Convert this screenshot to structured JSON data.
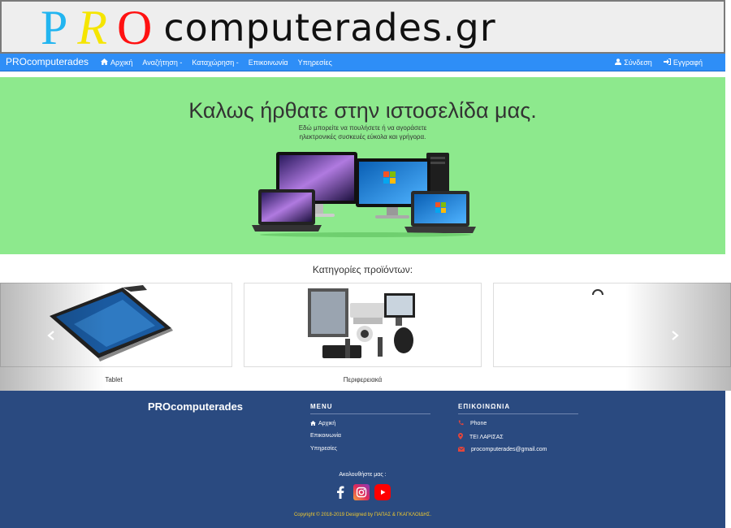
{
  "logo": {
    "letter_p": "P",
    "letter_r": "R",
    "letter_o": "O",
    "rest": "computerades.gr",
    "colors": {
      "p": "#22b5f0",
      "r": "#f5e500",
      "o": "#ff1111"
    }
  },
  "navbar": {
    "brand": "PROcomputerades",
    "links": [
      {
        "label": "Αρχική",
        "icon": "home-icon"
      },
      {
        "label": "Αναζήτηση -"
      },
      {
        "label": "Καταχώρηση -"
      },
      {
        "label": "Επικοινωνία"
      },
      {
        "label": "Υπηρεσίες"
      }
    ],
    "right": [
      {
        "label": "Σύνδεση",
        "icon": "user-icon"
      },
      {
        "label": "Εγγραφή",
        "icon": "sign-in-icon"
      }
    ],
    "color": "#2e8ef7"
  },
  "hero": {
    "title": "Καλως ήρθατε στην ιστοσελίδα μας.",
    "subtitle_line1": "Εδώ μπορείτε να πουλήσετε ή να αγοράσετε",
    "subtitle_line2": "ηλεκτρονικές συσκευές εύκολα και γρήγορα.",
    "background": "#8de98d"
  },
  "categories": {
    "title": "Κατηγορίες προϊόντων:",
    "items": [
      {
        "label": "Tablet"
      },
      {
        "label": "Περιφερειακά"
      },
      {
        "label": ""
      }
    ],
    "prev_icon": "chevron-left-icon",
    "next_icon": "chevron-right-icon"
  },
  "footer": {
    "brand": "PROcomputerades",
    "menu_heading": "MENU",
    "menu_items": [
      "Αρχική",
      "Επικοινωνία",
      "Υπηρεσίες"
    ],
    "contact_heading": "ΕΠΙΚΟΙΝΩΝΙΑ",
    "contact_items": [
      {
        "label": "Phone",
        "icon": "phone-icon"
      },
      {
        "label": "ΤΕΙ ΛΑΡΙΣΑΣ",
        "icon": "map-marker-icon"
      },
      {
        "label": "procomputerades@gmail.com",
        "icon": "envelope-icon"
      }
    ],
    "follow": "Ακολουθήστε μας :",
    "socials": [
      "facebook-icon",
      "instagram-icon",
      "youtube-icon"
    ],
    "copyright": "Copyright © 2018-2019 Designed by ΠΑΠΑΣ & ΓΚΑΓΚΛΟΙΔΗΣ.",
    "background": "#2a4a80"
  }
}
